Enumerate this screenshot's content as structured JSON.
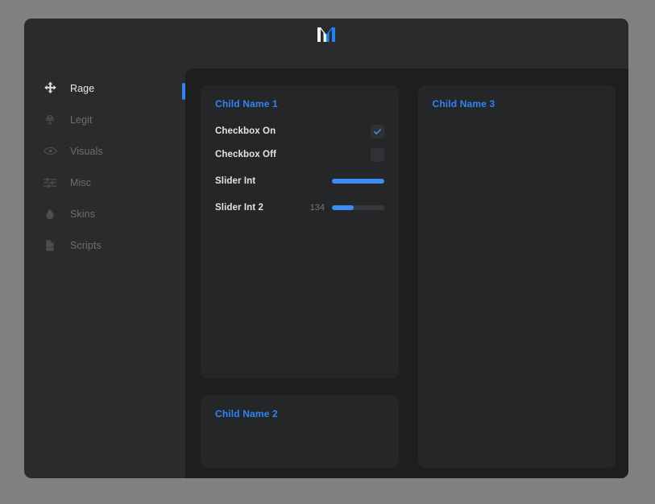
{
  "window": {
    "logo_name": "m-logo",
    "background": "#2a2b2d",
    "content_background": "#1d1e20",
    "accent": "#2f84f6"
  },
  "sidebar": {
    "items": [
      {
        "label": "Rage",
        "icon": "move-arrows-icon",
        "active": true
      },
      {
        "label": "Legit",
        "icon": "spy-agent-icon",
        "active": false
      },
      {
        "label": "Visuals",
        "icon": "eye-icon",
        "active": false
      },
      {
        "label": "Misc",
        "icon": "sliders-icon",
        "active": false
      },
      {
        "label": "Skins",
        "icon": "water-drop-icon",
        "active": false
      },
      {
        "label": "Scripts",
        "icon": "code-file-icon",
        "active": false
      }
    ]
  },
  "groups": {
    "child1": {
      "title": "Child Name 1",
      "controls": {
        "checkbox_on": {
          "label": "Checkbox On",
          "checked": true
        },
        "checkbox_off": {
          "label": "Checkbox Off",
          "checked": false
        },
        "slider_int": {
          "label": "Slider Int",
          "value": "",
          "percent": 100
        },
        "slider_int_2": {
          "label": "Slider Int 2",
          "value": "134",
          "percent": 42
        }
      }
    },
    "child2": {
      "title": "Child Name 2"
    },
    "child3": {
      "title": "Child Name 3"
    }
  }
}
